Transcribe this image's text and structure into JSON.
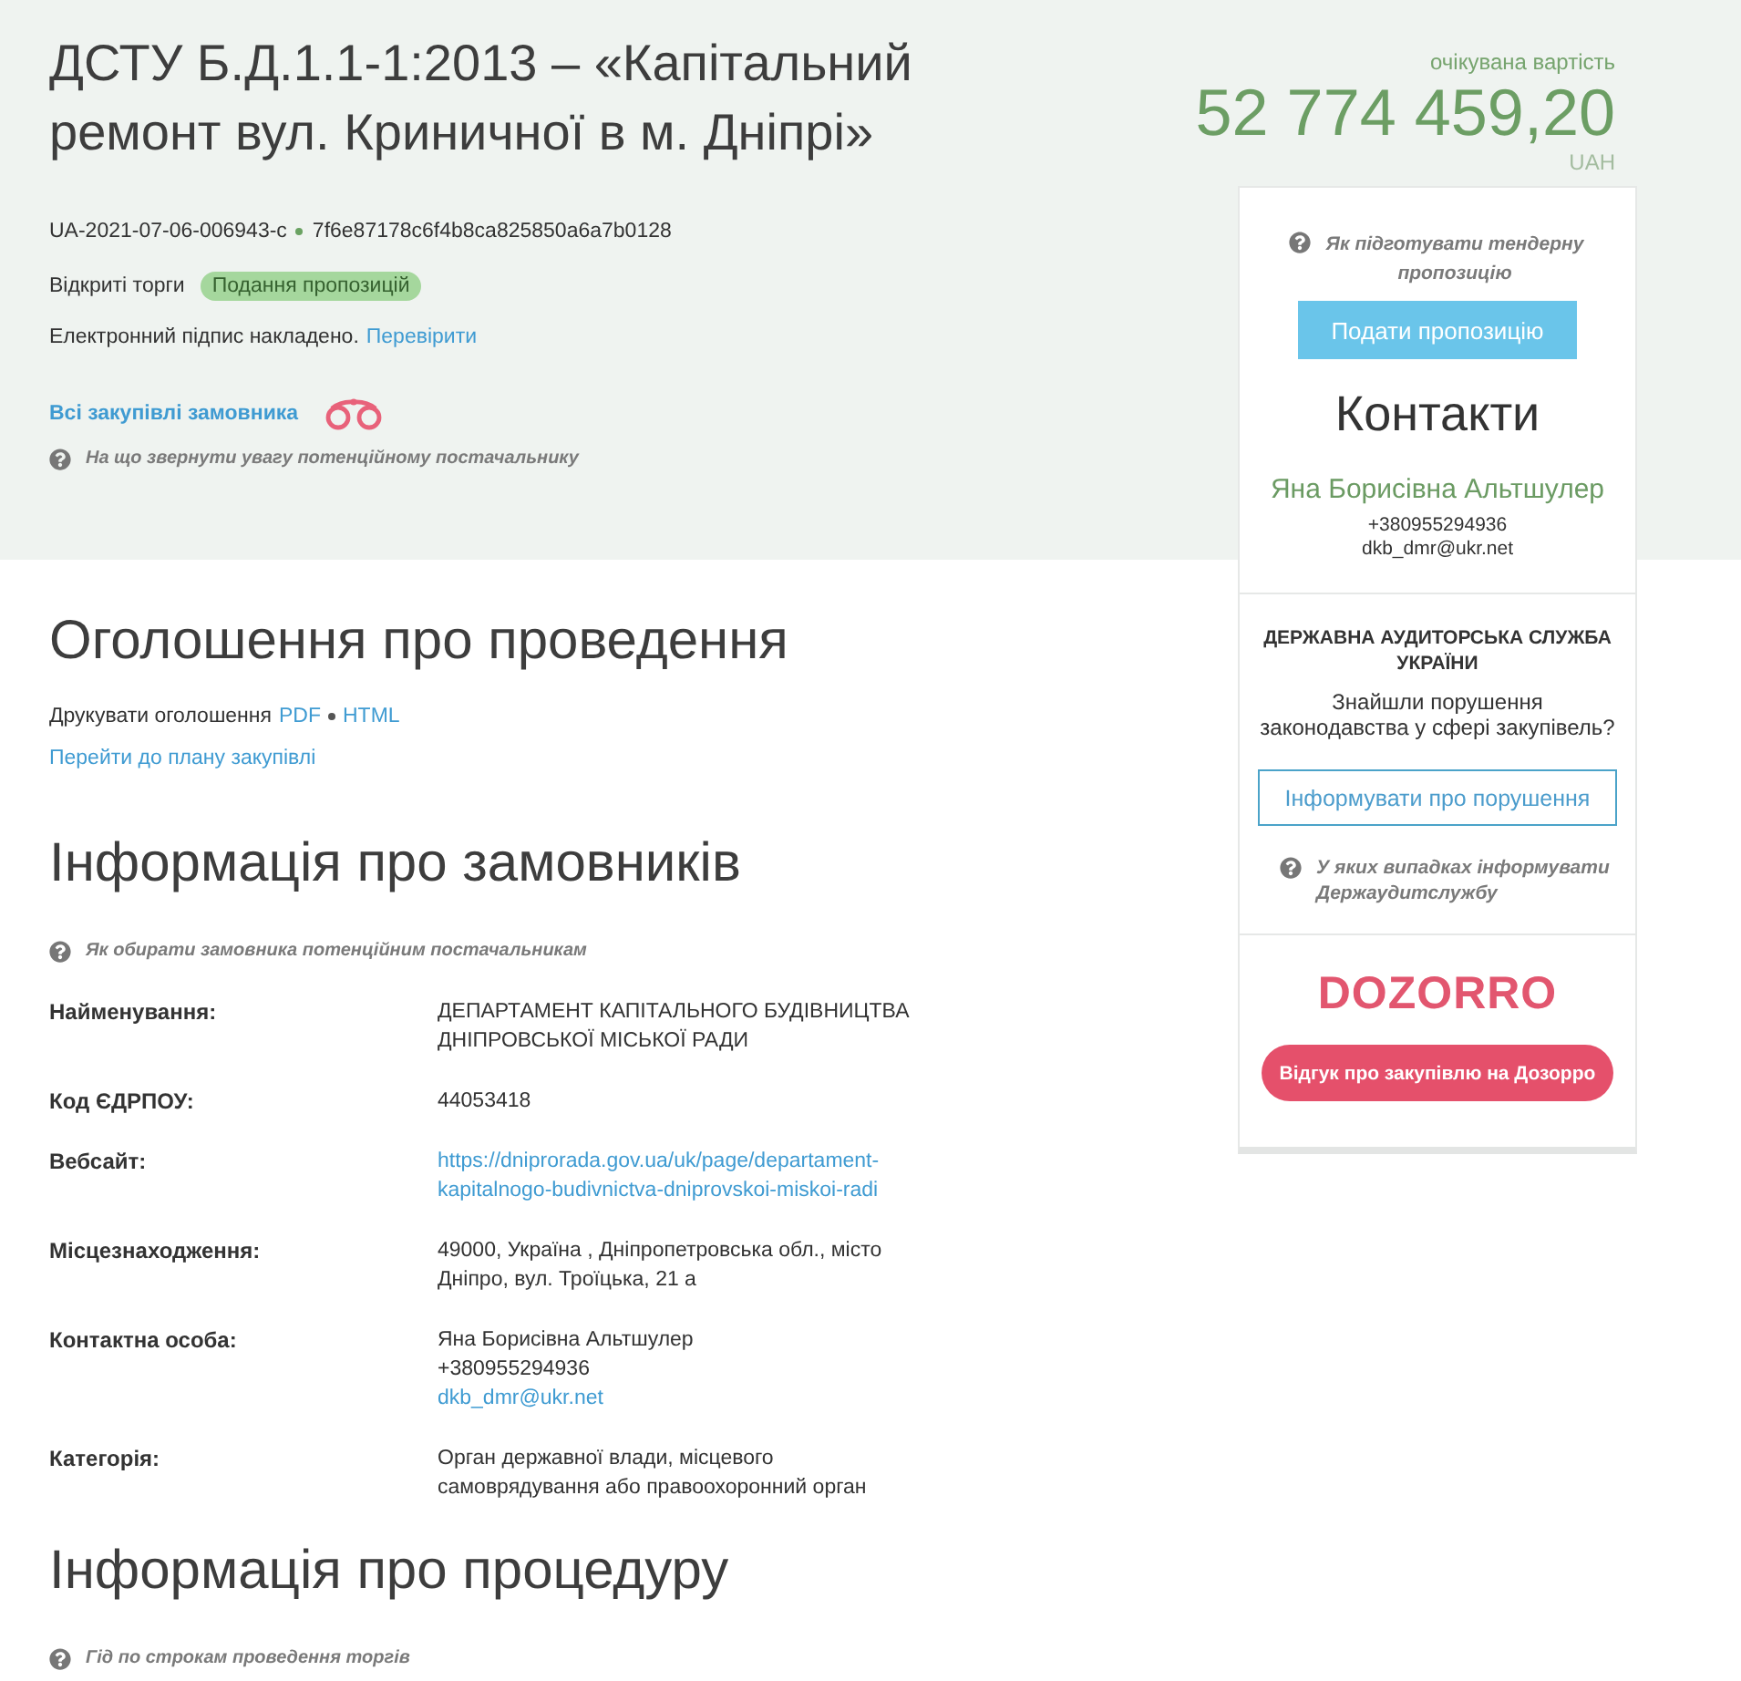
{
  "header": {
    "title": "ДСТУ Б.Д.1.1-1:2013 – «Капітальний ремонт вул. Криничної в м. Дніпрі»",
    "tender_id": "UA-2021-07-06-006943-c",
    "hash": "7f6e87178c6f4b8ca825850a6a7b0128",
    "procedure_type": "Відкриті торги",
    "status_badge": "Подання пропозицій",
    "signature_text": "Електронний підпис накладено.",
    "signature_link": "Перевірити",
    "customer_link": "Всі закупівлі замовника",
    "help_link": "На що звернути увагу потенційному постачальнику"
  },
  "price": {
    "label": "очікувана вартість",
    "amount": "52 774 459,20",
    "currency": "UAH"
  },
  "sidebar": {
    "help_link": "Як підготувати тендерну пропозицію",
    "submit_button": "Подати пропозицію",
    "contacts": {
      "title": "Контакти",
      "name": "Яна Борисівна Альтшулер",
      "phone": "+380955294936",
      "email": "dkb_dmr@ukr.net"
    },
    "audit": {
      "title": "ДЕРЖАВНА АУДИТОРСЬКА СЛУЖБА УКРАЇНИ",
      "text": "Знайшли порушення законодавства у сфері закупівель?",
      "button": "Інформувати про порушення",
      "help_link": "У яких випадках інформувати Держаудитслужбу"
    },
    "dozorro": {
      "logo": "DOZORRO",
      "button": "Відгук про закупівлю на Дозорро"
    }
  },
  "announcement": {
    "title": "Оголошення про проведення",
    "print_label": "Друкувати оголошення",
    "print_links": [
      "PDF",
      "HTML"
    ],
    "plan_link": "Перейти до плану закупівлі"
  },
  "customer_info": {
    "title": "Інформація про замовників",
    "help_link": "Як обирати замовника потенційним постачальникам",
    "fields": [
      {
        "label": "Найменування:",
        "values": [
          {
            "kind": "text",
            "text": "ДЕПАРТАМЕНТ КАПІТАЛЬНОГО БУДІВНИЦТВА ДНІПРОВСЬКОЇ МІСЬКОЇ РАДИ"
          }
        ]
      },
      {
        "label": "Код ЄДРПОУ:",
        "values": [
          {
            "kind": "text",
            "text": "44053418"
          }
        ]
      },
      {
        "label": "Вебсайт:",
        "values": [
          {
            "kind": "link",
            "text": "https://dniprorada.gov.ua/uk/page/departament-kapitalnogo-budivnictva-dniprovskoi-miskoi-radi"
          }
        ]
      },
      {
        "label": "Місцезнаходження:",
        "values": [
          {
            "kind": "text",
            "text": "49000, Україна , Дніпропетровська обл., місто Дніпро, вул. Троїцька, 21 а"
          }
        ]
      },
      {
        "label": "Контактна особа:",
        "values": [
          {
            "kind": "text",
            "text": "Яна Борисівна Альтшулер"
          },
          {
            "kind": "text",
            "text": "+380955294936"
          },
          {
            "kind": "link",
            "text": "dkb_dmr@ukr.net"
          }
        ]
      },
      {
        "label": "Категорія:",
        "values": [
          {
            "kind": "text",
            "text": "Орган державної влади, місцевого самоврядування або правоохоронний орган"
          }
        ]
      }
    ]
  },
  "procedure_info": {
    "title": "Інформація про процедуру",
    "help_link": "Гід по строкам проведення торгів"
  }
}
